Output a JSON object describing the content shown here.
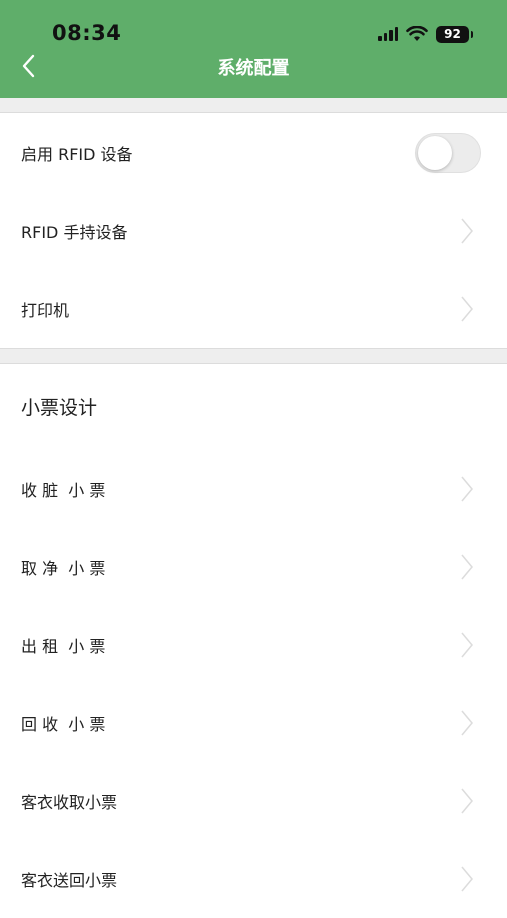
{
  "status_bar": {
    "time": "08:34",
    "battery": "92"
  },
  "nav": {
    "title": "系统配置",
    "back_icon": "chevron-left-icon"
  },
  "device_section": {
    "rfid_enable": {
      "label": "启用 RFID 设备",
      "enabled": false
    },
    "rfid_handheld": {
      "label": "RFID 手持设备"
    },
    "printer": {
      "label": "打印机"
    }
  },
  "receipt_section": {
    "title": "小票设计",
    "items": [
      {
        "label": "收 脏  小 票"
      },
      {
        "label": "取 净  小 票"
      },
      {
        "label": "出 租  小 票"
      },
      {
        "label": "回 收  小 票"
      },
      {
        "label": "客衣收取小票"
      },
      {
        "label": "客衣送回小票"
      }
    ]
  },
  "colors": {
    "header": "#5fae6a",
    "separator": "#eeeeee"
  }
}
